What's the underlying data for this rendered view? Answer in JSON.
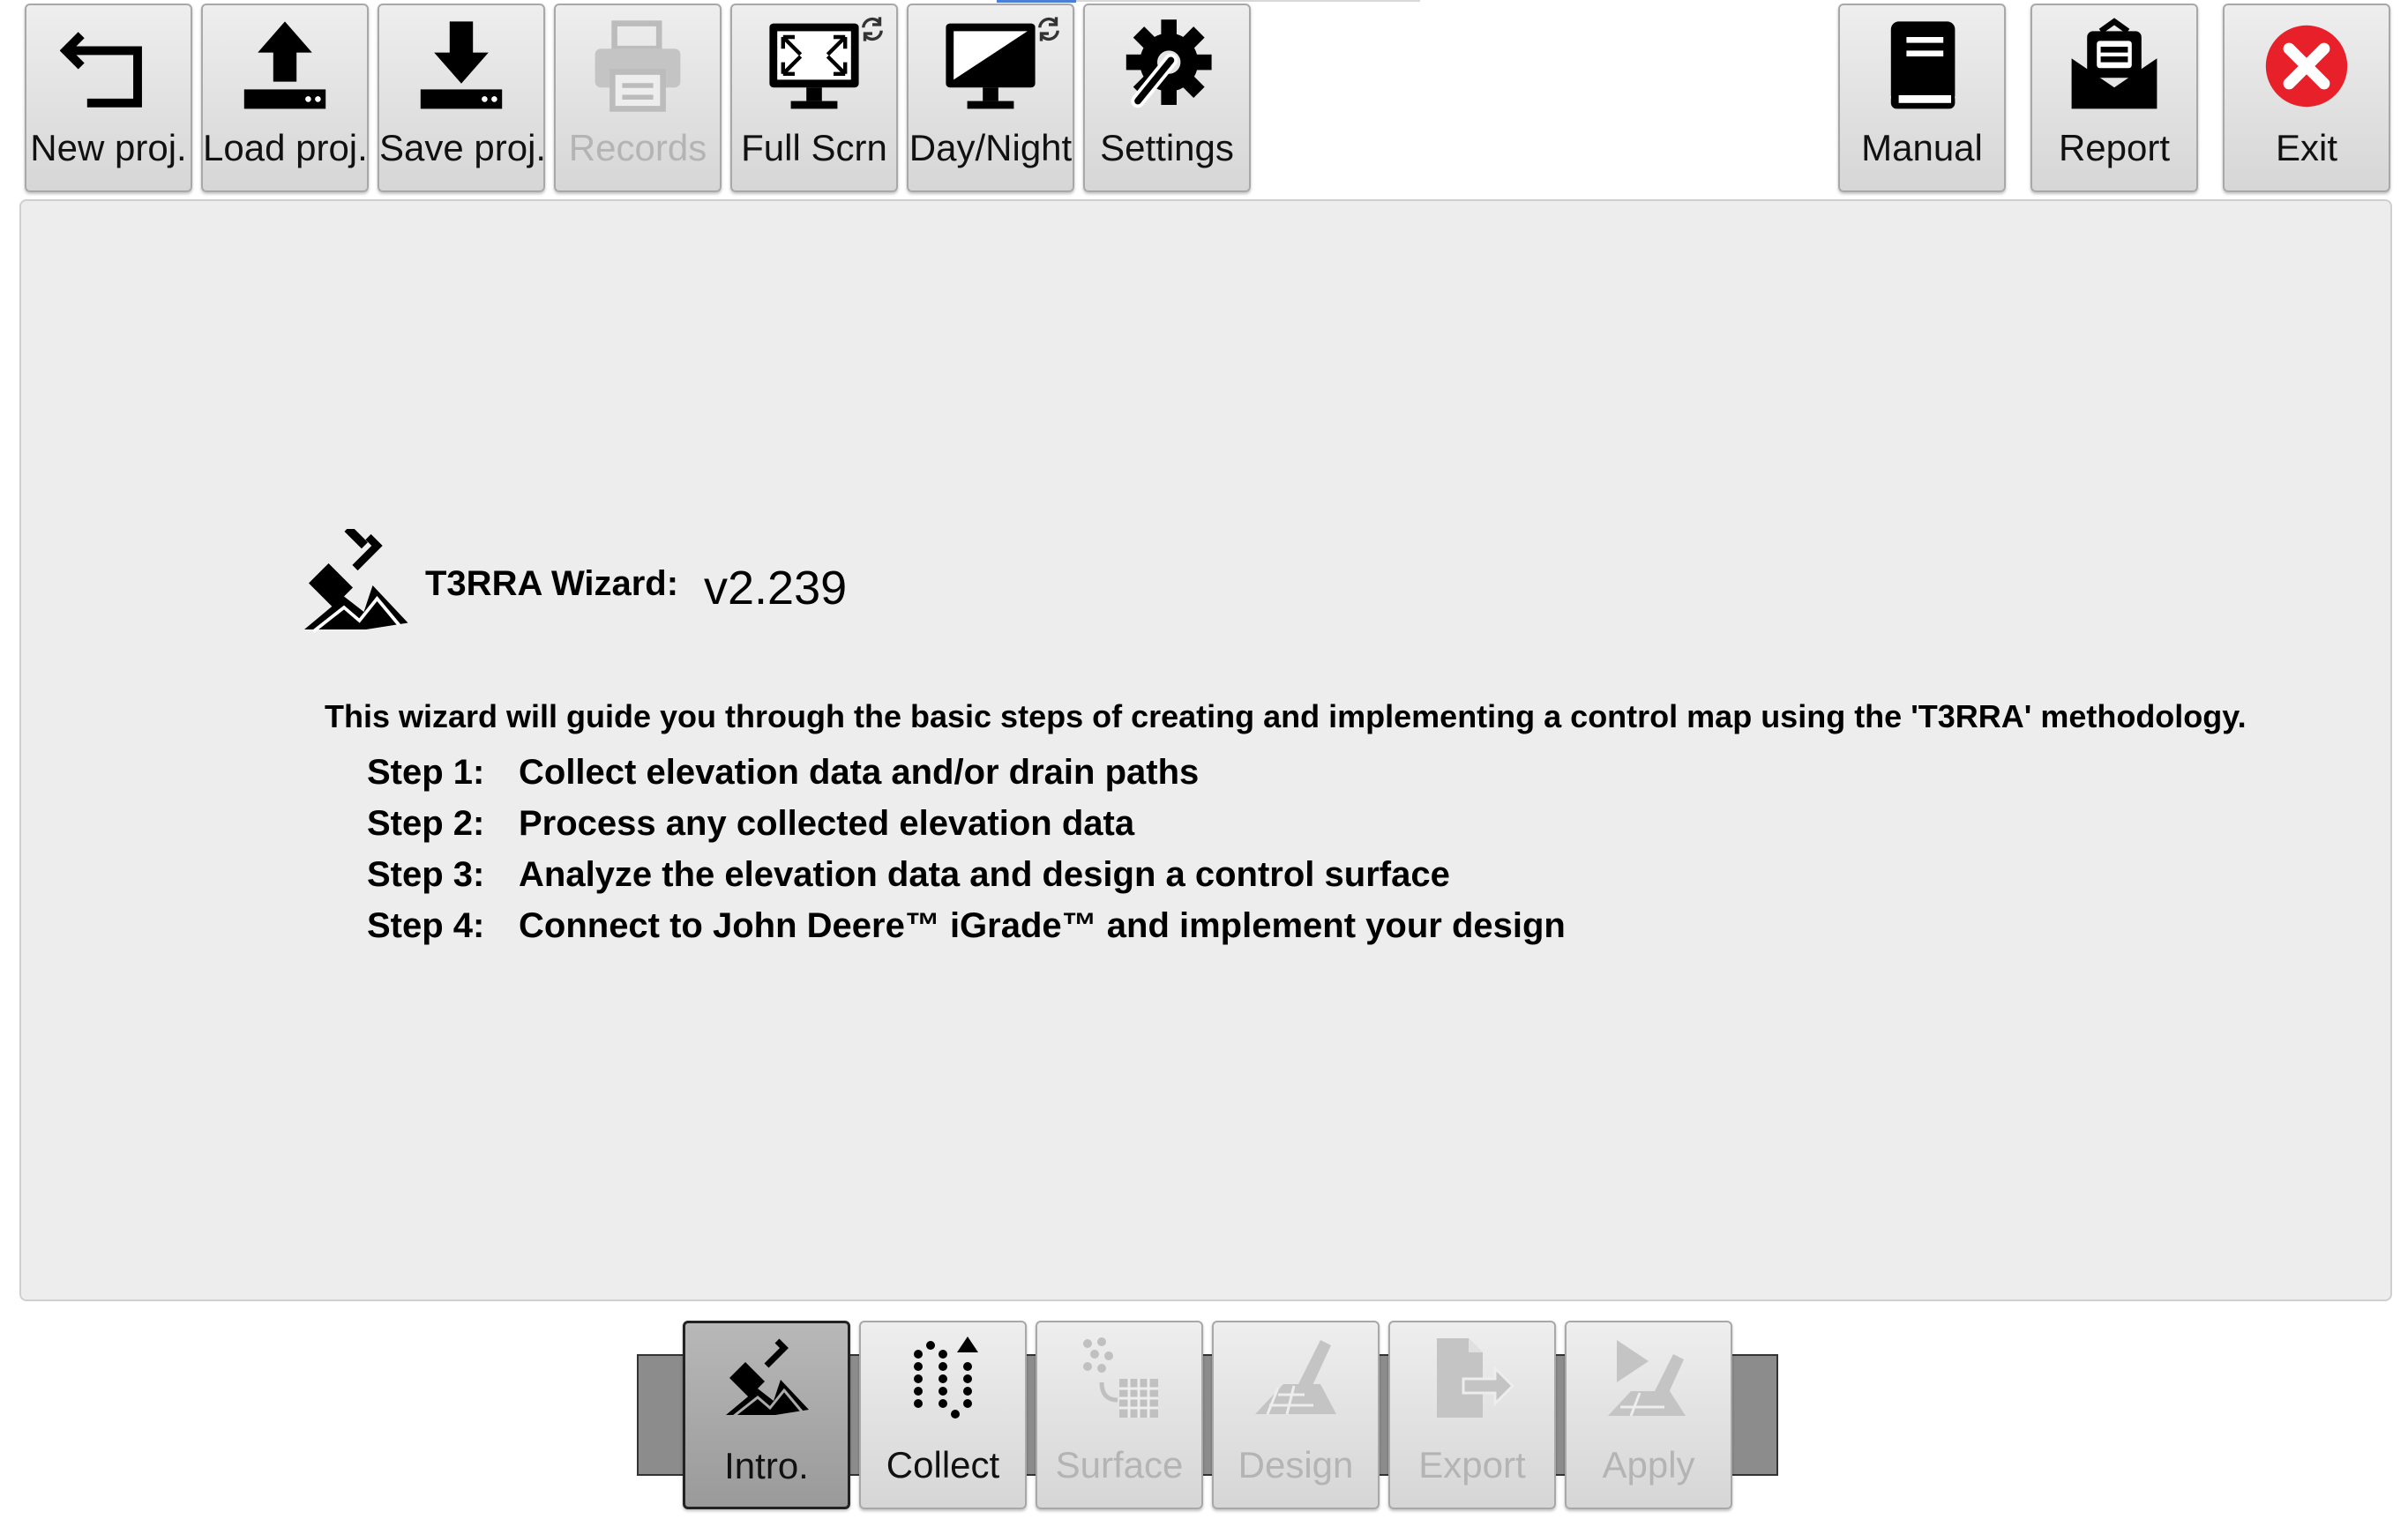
{
  "toolbar": {
    "new_proj": "New proj.",
    "load_proj": "Load proj.",
    "save_proj": "Save proj.",
    "records": "Records",
    "full_scrn": "Full Scrn",
    "day_night": "Day/Night",
    "settings": "Settings",
    "manual": "Manual",
    "report": "Report",
    "exit": "Exit"
  },
  "wizard": {
    "title": "T3RRA Wizard:",
    "version": "v2.239",
    "intro": "This wizard will guide you through the basic steps of creating and implementing a control map using the 'T3RRA' methodology.",
    "steps": [
      {
        "label": "Step 1:",
        "text": "Collect elevation data and/or drain paths"
      },
      {
        "label": "Step 2:",
        "text": "Process any collected elevation data"
      },
      {
        "label": "Step 3:",
        "text": "Analyze the elevation data and design a control surface"
      },
      {
        "label": "Step 4:",
        "text": "Connect to John Deere™ iGrade™ and implement your design"
      }
    ]
  },
  "nav": {
    "intro": "Intro.",
    "collect": "Collect",
    "surface": "Surface",
    "design": "Design",
    "export": "Export",
    "apply": "Apply"
  },
  "colors": {
    "exit_red": "#e8202a",
    "disabled_text": "#b4b4b4",
    "panel_bg": "#ededed"
  }
}
